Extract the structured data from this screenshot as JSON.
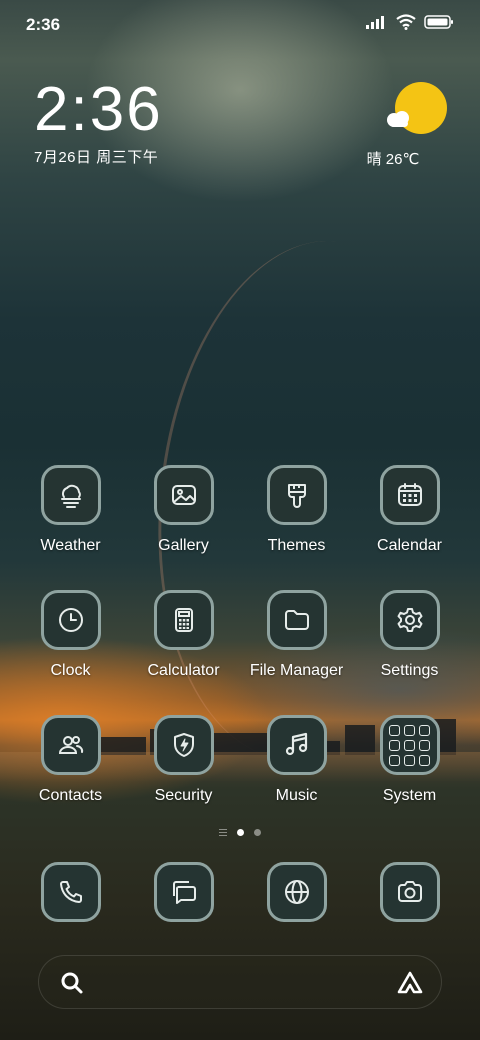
{
  "status_bar": {
    "time": "2:36",
    "icons": [
      "signal-icon",
      "wifi-icon",
      "battery-icon"
    ]
  },
  "clock_widget": {
    "time": "2:36",
    "date": "7月26日 周三下午"
  },
  "weather_widget": {
    "icon": "partly-sunny-icon",
    "text": "晴 26℃",
    "sun_color": "#f4c414"
  },
  "apps": [
    {
      "label": "Weather",
      "icon": "weather-fog-icon"
    },
    {
      "label": "Gallery",
      "icon": "gallery-icon"
    },
    {
      "label": "Themes",
      "icon": "themes-brush-icon"
    },
    {
      "label": "Calendar",
      "icon": "calendar-icon"
    },
    {
      "label": "Clock",
      "icon": "clock-icon"
    },
    {
      "label": "Calculator",
      "icon": "calculator-icon"
    },
    {
      "label": "File Manager",
      "icon": "folder-icon"
    },
    {
      "label": "Settings",
      "icon": "gear-icon"
    },
    {
      "label": "Contacts",
      "icon": "contacts-icon"
    },
    {
      "label": "Security",
      "icon": "security-shield-icon"
    },
    {
      "label": "Music",
      "icon": "music-note-icon"
    },
    {
      "label": "System",
      "icon": "folder-grid-icon"
    }
  ],
  "page_indicator": {
    "pages": 2,
    "active_page": 1
  },
  "dock": [
    {
      "icon": "phone-icon"
    },
    {
      "icon": "messages-icon"
    },
    {
      "icon": "browser-globe-icon"
    },
    {
      "icon": "camera-icon"
    }
  ],
  "search_bar": {
    "left_icon": "search-icon",
    "right_icon": "assistant-icon"
  },
  "colors": {
    "icon_bg": "#253432",
    "icon_border": "#8fa3a0",
    "icon_glyph": "#e6ecea"
  }
}
